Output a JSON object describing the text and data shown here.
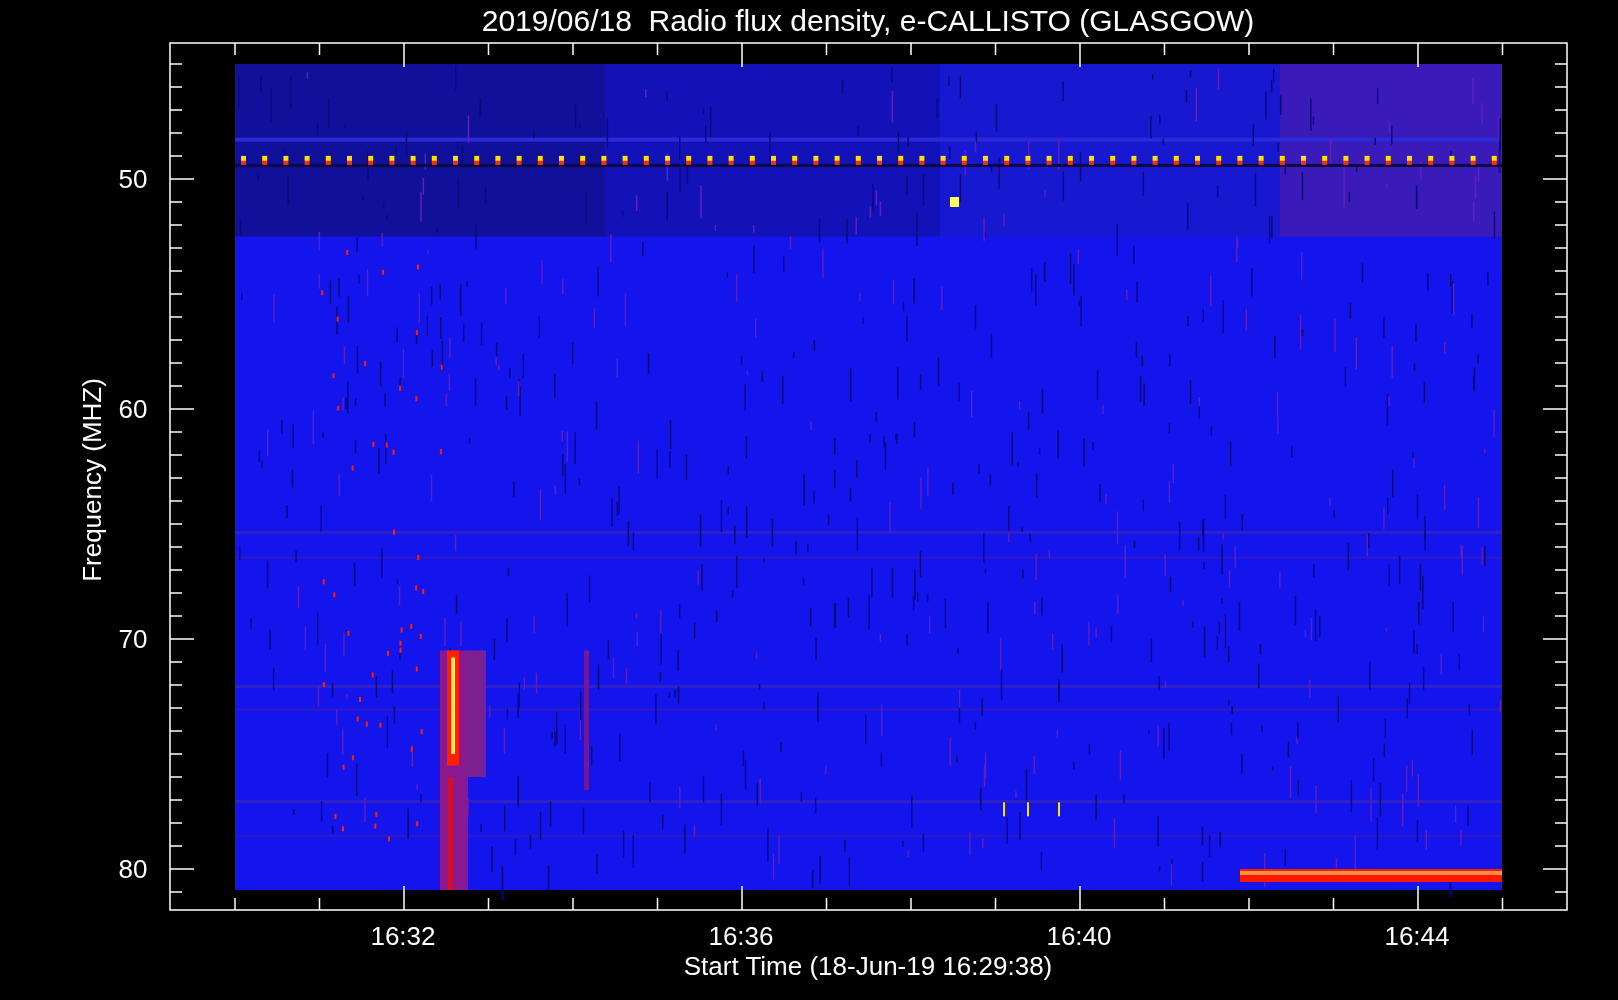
{
  "plot": {
    "title": "2019/06/18  Radio flux density, e-CALLISTO (GLASGOW)",
    "ylabel": "Frequency (MHZ)",
    "xlabel": "Start Time (18-Jun-19 16:29:38)",
    "yticks": [
      "50",
      "60",
      "70",
      "80"
    ],
    "xticks": [
      "16:32",
      "16:36",
      "16:40",
      "16:44"
    ]
  }
}
